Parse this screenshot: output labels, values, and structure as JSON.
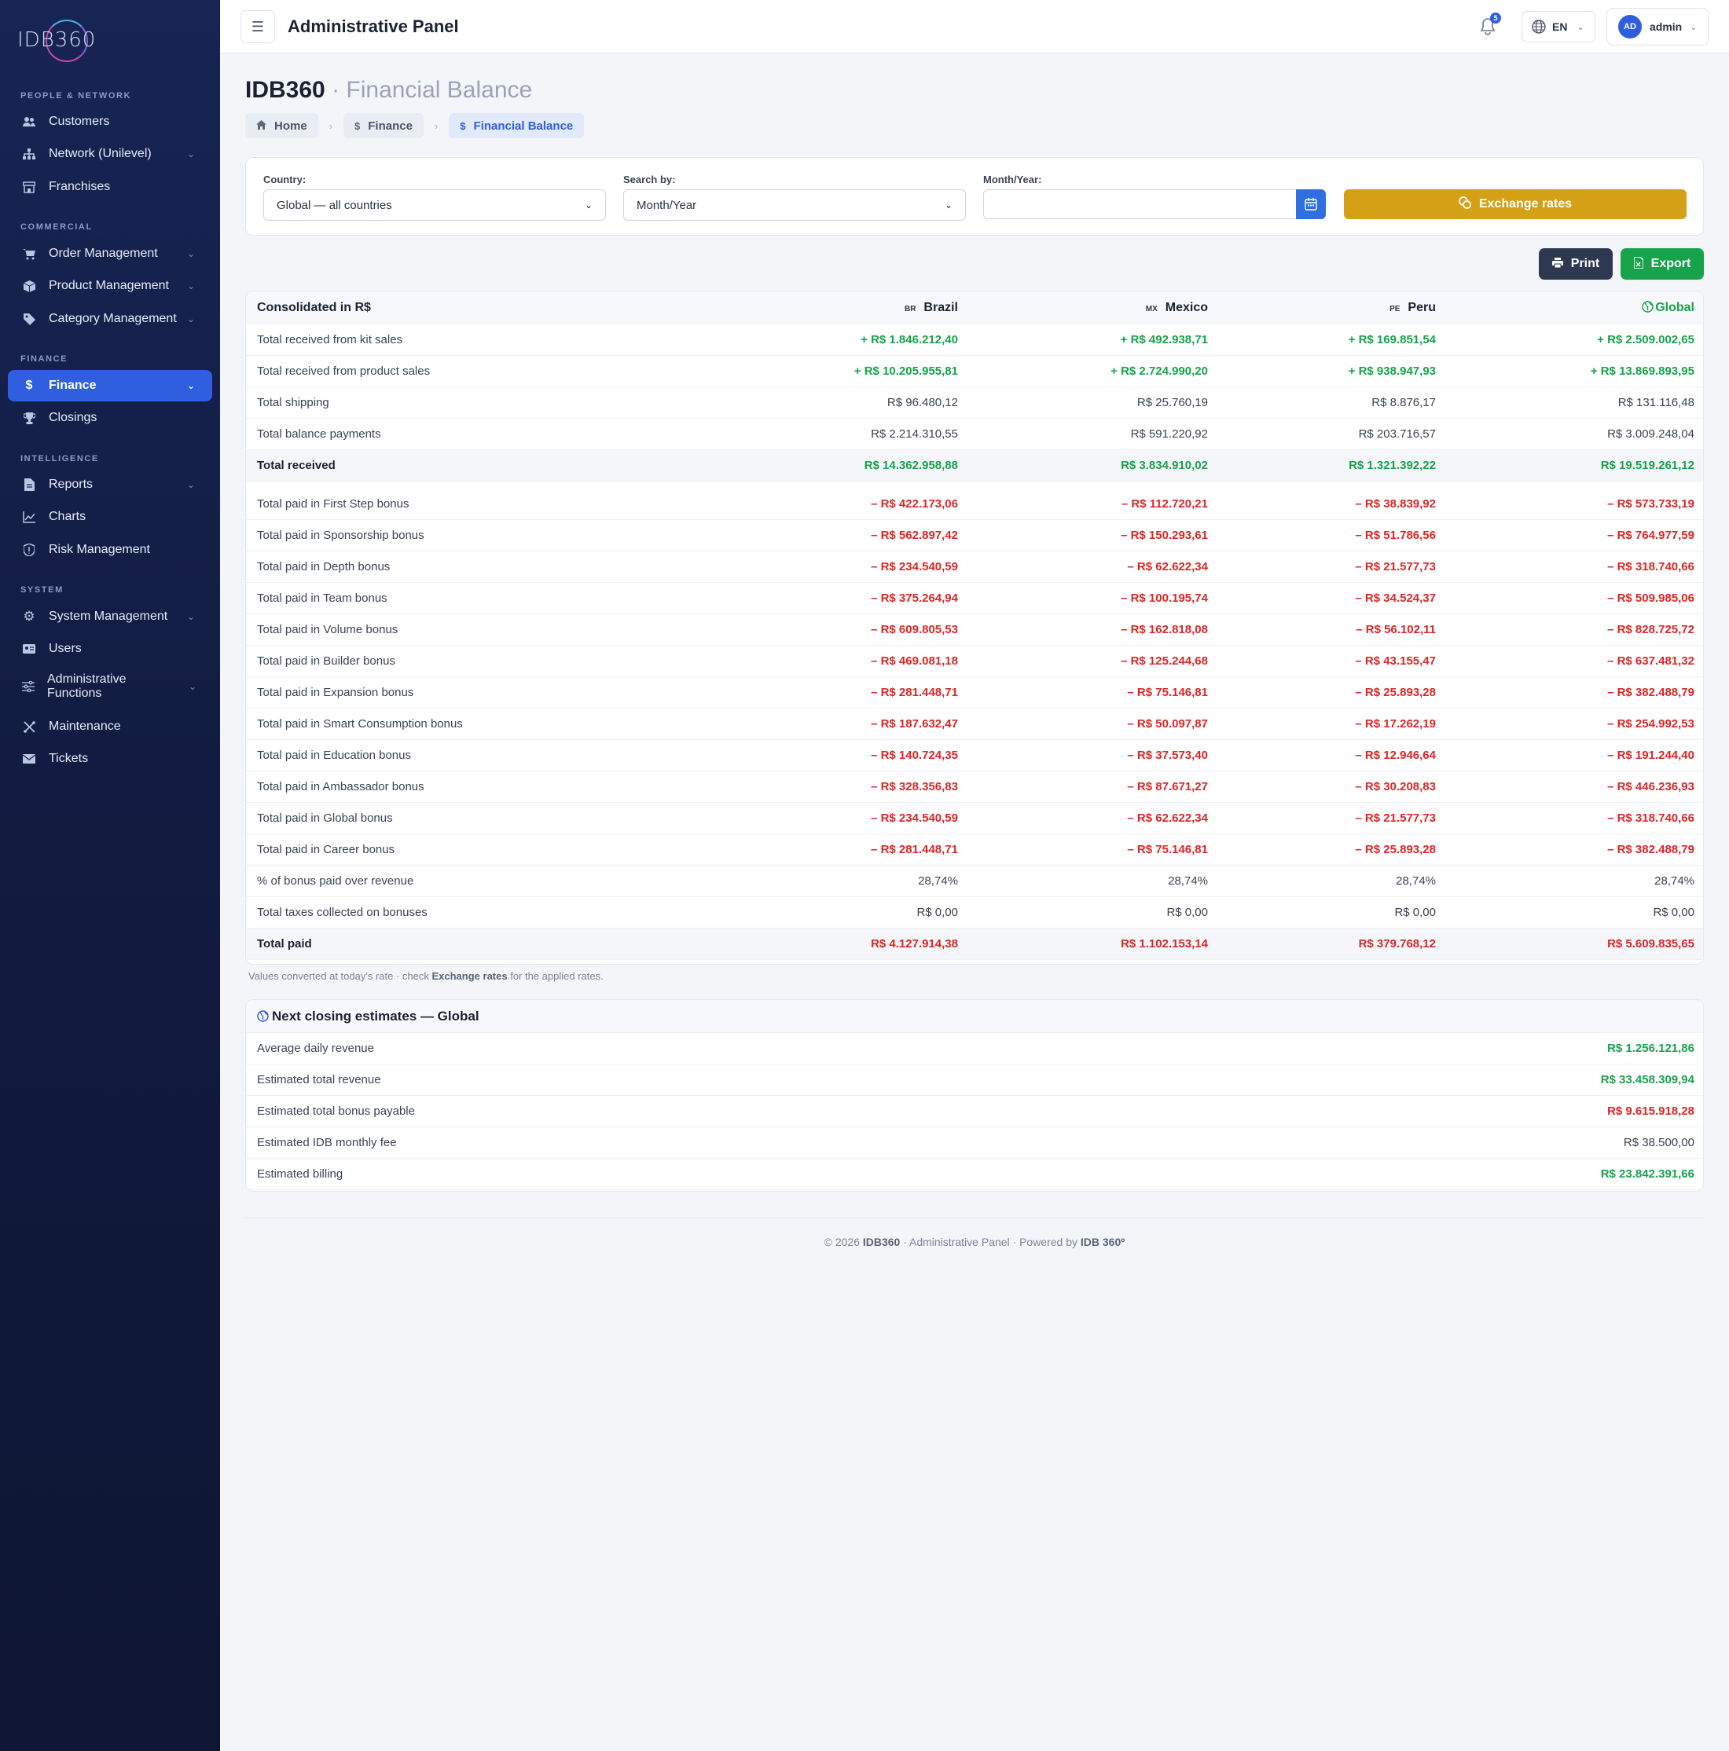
{
  "brand": {
    "logo_text": "IDB360"
  },
  "sidebar": {
    "sections": [
      {
        "title": "PEOPLE & NETWORK"
      },
      {
        "title": "COMMERCIAL"
      },
      {
        "title": "FINANCE"
      },
      {
        "title": "INTELLIGENCE"
      },
      {
        "title": "SYSTEM"
      }
    ],
    "items": [
      {
        "label": "Customers",
        "icon": "users-icon"
      },
      {
        "label": "Network (Unilevel)",
        "icon": "network-icon"
      },
      {
        "label": "Franchises",
        "icon": "store-icon"
      },
      {
        "label": "Order Management",
        "icon": "cart-icon"
      },
      {
        "label": "Product Management",
        "icon": "box-icon"
      },
      {
        "label": "Category Management",
        "icon": "tag-icon"
      },
      {
        "label": "Finance",
        "icon": "dollar-icon",
        "active": true
      },
      {
        "label": "Closings",
        "icon": "trophy-icon"
      },
      {
        "label": "Reports",
        "icon": "file-icon"
      },
      {
        "label": "Charts",
        "icon": "chart-line-icon"
      },
      {
        "label": "Risk Management",
        "icon": "shield-icon"
      },
      {
        "label": "System Management",
        "icon": "gear-icon"
      },
      {
        "label": "Users",
        "icon": "id-card-icon"
      },
      {
        "label": "Administrative Functions",
        "icon": "sliders-icon"
      },
      {
        "label": "Maintenance",
        "icon": "tools-icon"
      },
      {
        "label": "Tickets",
        "icon": "envelope-icon"
      }
    ]
  },
  "topbar": {
    "title": "Administrative Panel",
    "notifications_count": "5",
    "language": "EN",
    "user_initials": "AD",
    "user_name": "admin"
  },
  "page": {
    "title_main": "IDB360",
    "title_sub": "· Financial Balance",
    "breadcrumbs": [
      {
        "label": "Home"
      },
      {
        "label": "Finance"
      },
      {
        "label": "Financial Balance"
      }
    ]
  },
  "filters": {
    "country_label": "Country:",
    "country_value": "Global — all countries",
    "search_label": "Search by:",
    "search_value": "Month/Year",
    "month_label": "Month/Year:",
    "month_value": "",
    "exchange_button": "Exchange rates"
  },
  "actions": {
    "print": "Print",
    "export": "Export"
  },
  "balance_table": {
    "header": {
      "label": "Consolidated in R$",
      "col1_flag": "BR",
      "col1": "Brazil",
      "col2_flag": "MX",
      "col2": "Mexico",
      "col3_flag": "PE",
      "col3": "Peru",
      "col4": "Global"
    },
    "rows": [
      {
        "label": "Total received from kit sales",
        "v": [
          "+ R$ 1.846.212,40",
          "+ R$ 492.938,71",
          "+ R$ 169.851,54",
          "+ R$ 2.509.002,65"
        ],
        "tone": "pos"
      },
      {
        "label": "Total received from product sales",
        "v": [
          "+ R$ 10.205.955,81",
          "+ R$ 2.724.990,20",
          "+ R$ 938.947,93",
          "+ R$ 13.869.893,95"
        ],
        "tone": "pos"
      },
      {
        "label": "Total shipping",
        "v": [
          "R$ 96.480,12",
          "R$ 25.760,19",
          "R$ 8.876,17",
          "R$ 131.116,48"
        ],
        "tone": "neu"
      },
      {
        "label": "Total balance payments",
        "v": [
          "R$ 2.214.310,55",
          "R$ 591.220,92",
          "R$ 203.716,57",
          "R$ 3.009.248,04"
        ],
        "tone": "neu"
      },
      {
        "label": "Total received",
        "v": [
          "R$ 14.362.958,88",
          "R$ 3.834.910,02",
          "R$ 1.321.392,22",
          "R$ 19.519.261,12"
        ],
        "tone": "pos",
        "total": true
      },
      {
        "label": "Total paid in First Step bonus",
        "v": [
          "– R$ 422.173,06",
          "– R$ 112.720,21",
          "– R$ 38.839,92",
          "– R$ 573.733,19"
        ],
        "tone": "neg"
      },
      {
        "label": "Total paid in Sponsorship bonus",
        "v": [
          "– R$ 562.897,42",
          "– R$ 150.293,61",
          "– R$ 51.786,56",
          "– R$ 764.977,59"
        ],
        "tone": "neg"
      },
      {
        "label": "Total paid in Depth bonus",
        "v": [
          "– R$ 234.540,59",
          "– R$ 62.622,34",
          "– R$ 21.577,73",
          "– R$ 318.740,66"
        ],
        "tone": "neg"
      },
      {
        "label": "Total paid in Team bonus",
        "v": [
          "– R$ 375.264,94",
          "– R$ 100.195,74",
          "– R$ 34.524,37",
          "– R$ 509.985,06"
        ],
        "tone": "neg"
      },
      {
        "label": "Total paid in Volume bonus",
        "v": [
          "– R$ 609.805,53",
          "– R$ 162.818,08",
          "– R$ 56.102,11",
          "– R$ 828.725,72"
        ],
        "tone": "neg"
      },
      {
        "label": "Total paid in Builder bonus",
        "v": [
          "– R$ 469.081,18",
          "– R$ 125.244,68",
          "– R$ 43.155,47",
          "– R$ 637.481,32"
        ],
        "tone": "neg"
      },
      {
        "label": "Total paid in Expansion bonus",
        "v": [
          "– R$ 281.448,71",
          "– R$ 75.146,81",
          "– R$ 25.893,28",
          "– R$ 382.488,79"
        ],
        "tone": "neg"
      },
      {
        "label": "Total paid in Smart Consumption bonus",
        "v": [
          "– R$ 187.632,47",
          "– R$ 50.097,87",
          "– R$ 17.262,19",
          "– R$ 254.992,53"
        ],
        "tone": "neg"
      },
      {
        "label": "Total paid in Education bonus",
        "v": [
          "– R$ 140.724,35",
          "– R$ 37.573,40",
          "– R$ 12.946,64",
          "– R$ 191.244,40"
        ],
        "tone": "neg"
      },
      {
        "label": "Total paid in Ambassador bonus",
        "v": [
          "– R$ 328.356,83",
          "– R$ 87.671,27",
          "– R$ 30.208,83",
          "– R$ 446.236,93"
        ],
        "tone": "neg"
      },
      {
        "label": "Total paid in Global bonus",
        "v": [
          "– R$ 234.540,59",
          "– R$ 62.622,34",
          "– R$ 21.577,73",
          "– R$ 318.740,66"
        ],
        "tone": "neg"
      },
      {
        "label": "Total paid in Career bonus",
        "v": [
          "– R$ 281.448,71",
          "– R$ 75.146,81",
          "– R$ 25.893,28",
          "– R$ 382.488,79"
        ],
        "tone": "neg"
      },
      {
        "label": "% of bonus paid over revenue",
        "v": [
          "28,74%",
          "28,74%",
          "28,74%",
          "28,74%"
        ],
        "tone": "neu"
      },
      {
        "label": "Total taxes collected on bonuses",
        "v": [
          "R$ 0,00",
          "R$ 0,00",
          "R$ 0,00",
          "R$ 0,00"
        ],
        "tone": "neu"
      },
      {
        "label": "Total paid",
        "v": [
          "R$ 4.127.914,38",
          "R$ 1.102.153,14",
          "R$ 379.768,12",
          "R$ 5.609.835,65"
        ],
        "tone": "neg",
        "total": true
      }
    ]
  },
  "note": {
    "pre": "Values converted at today's rate · check ",
    "strong": "Exchange rates",
    "post": " for the applied rates."
  },
  "estimates": {
    "title": "Next closing estimates — Global",
    "rows": [
      {
        "label": "Average daily revenue",
        "value": "R$ 1.256.121,86",
        "tone": "pos"
      },
      {
        "label": "Estimated total revenue",
        "value": "R$ 33.458.309,94",
        "tone": "pos"
      },
      {
        "label": "Estimated total bonus payable",
        "value": "R$ 9.615.918,28",
        "tone": "neg"
      },
      {
        "label": "Estimated IDB monthly fee",
        "value": "R$ 38.500,00",
        "tone": "neu"
      },
      {
        "label": "Estimated billing",
        "value": "R$ 23.842.391,66",
        "tone": "pos"
      }
    ]
  },
  "footer": {
    "pre": "© 2026 ",
    "brand": "IDB360",
    "mid": " · Administrative Panel · Powered by ",
    "powered": "IDB 360º"
  },
  "colors": {
    "primary": "#2f5fde",
    "sidebar": "#172554",
    "positive": "#16a34a",
    "negative": "#dc2626",
    "gold": "#d4a015",
    "dark_button": "#2e3850"
  }
}
